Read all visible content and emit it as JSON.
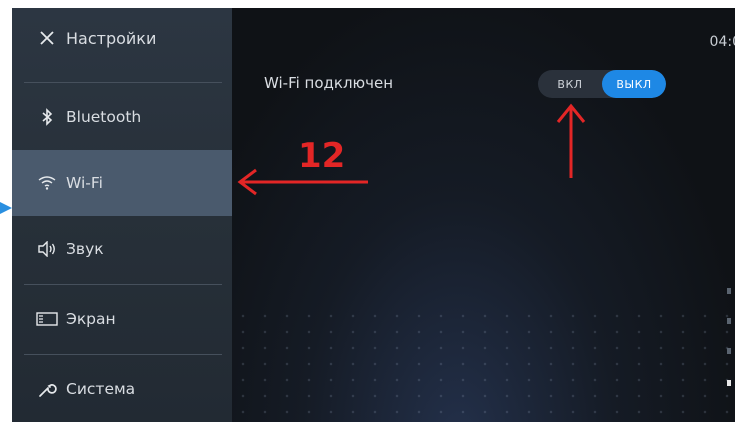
{
  "sidebar": {
    "header": {
      "label": "Настройки",
      "icon": "close-icon"
    },
    "items": [
      {
        "label": "Bluetooth",
        "icon": "bluetooth-icon",
        "active": false
      },
      {
        "label": "Wi-Fi",
        "icon": "wifi-icon",
        "active": true
      },
      {
        "label": "Звук",
        "icon": "speaker-icon",
        "active": false
      },
      {
        "label": "Экран",
        "icon": "screen-icon",
        "active": false
      },
      {
        "label": "Система",
        "icon": "wrench-icon",
        "active": false
      }
    ]
  },
  "status": {
    "time": "04:0"
  },
  "wifi": {
    "label": "Wi-Fi подключен",
    "toggle": {
      "on_label": "ВКЛ",
      "off_label": "ВЫКЛ",
      "selected": "off"
    }
  },
  "annotation": {
    "number": "12",
    "color": "#e32626"
  },
  "colors": {
    "accent": "#1e88e5",
    "active_item": "#4a5a6d",
    "sidebar": "#2a333d"
  }
}
